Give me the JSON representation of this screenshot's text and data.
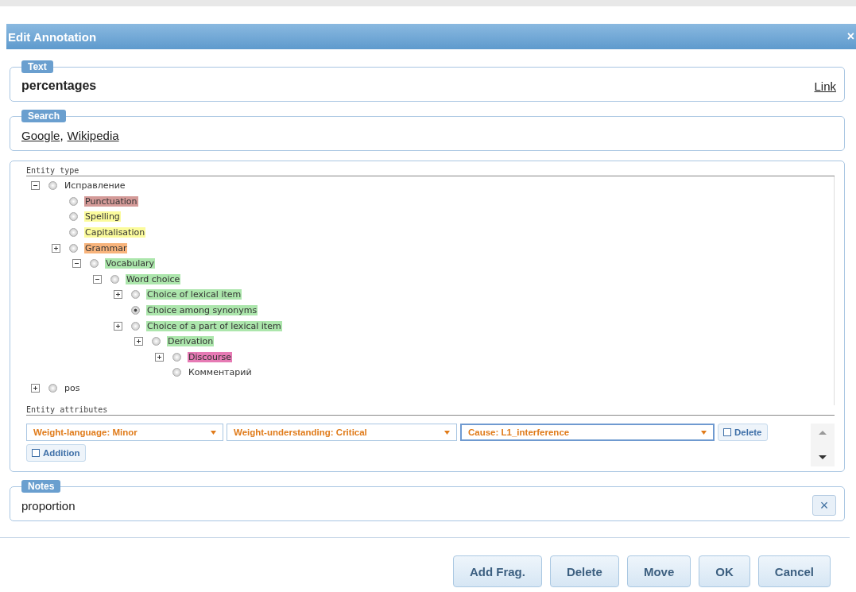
{
  "dialog": {
    "title": "Edit Annotation",
    "close": "×"
  },
  "text_section": {
    "legend": "Text",
    "value": "percentages",
    "link": "Link"
  },
  "search_section": {
    "legend": "Search",
    "links": [
      "Google",
      "Wikipedia"
    ],
    "separator": ","
  },
  "entity_type": {
    "heading": "Entity type",
    "tree": [
      {
        "label": "Исправление",
        "expanded": true,
        "selected": false,
        "children": [
          {
            "label": "Punctuation",
            "color": "#d49a98",
            "selected": false
          },
          {
            "label": "Spelling",
            "color": "#fbfb9c",
            "selected": false
          },
          {
            "label": "Capitalisation",
            "color": "#fbfb9c",
            "selected": false
          },
          {
            "label": "Grammar",
            "color": "#f8b47c",
            "expanded": false,
            "selected": false,
            "children": [
              {
                "label": "Vocabulary",
                "color": "#ace6ac",
                "expanded": true,
                "selected": false,
                "children": [
                  {
                    "label": "Word choice",
                    "color": "#ace6ac",
                    "expanded": true,
                    "selected": false,
                    "children": [
                      {
                        "label": "Choice of lexical item",
                        "color": "#ace6ac",
                        "expanded": false,
                        "selected": false
                      },
                      {
                        "label": "Choice among synonyms",
                        "color": "#ace6ac",
                        "selected": true
                      },
                      {
                        "label": "Choice of a part of lexical item",
                        "color": "#ace6ac",
                        "expanded": false,
                        "selected": false,
                        "children": [
                          {
                            "label": "Derivation",
                            "color": "#ace6ac",
                            "expanded": false,
                            "selected": false,
                            "children": [
                              {
                                "label": "Discourse",
                                "color": "#e67ab4",
                                "expanded": false,
                                "selected": false
                              },
                              {
                                "label": "Комментарий",
                                "selected": false
                              }
                            ]
                          }
                        ]
                      }
                    ]
                  }
                ]
              }
            ]
          }
        ]
      },
      {
        "label": "pos",
        "expanded": false,
        "selected": false
      }
    ]
  },
  "entity_attributes": {
    "heading": "Entity attributes",
    "selects": [
      {
        "label": "Weight-language: Minor",
        "focused": false
      },
      {
        "label": "Weight-understanding: Critical",
        "focused": false
      },
      {
        "label": "Cause: L1_interference",
        "focused": true
      }
    ],
    "checks": [
      {
        "label": "Delete",
        "checked": false
      },
      {
        "label": "Addition",
        "checked": false
      }
    ]
  },
  "notes_section": {
    "legend": "Notes",
    "value": "proportion",
    "clear": "×"
  },
  "buttons": [
    "Add Frag.",
    "Delete",
    "Move",
    "OK",
    "Cancel"
  ]
}
